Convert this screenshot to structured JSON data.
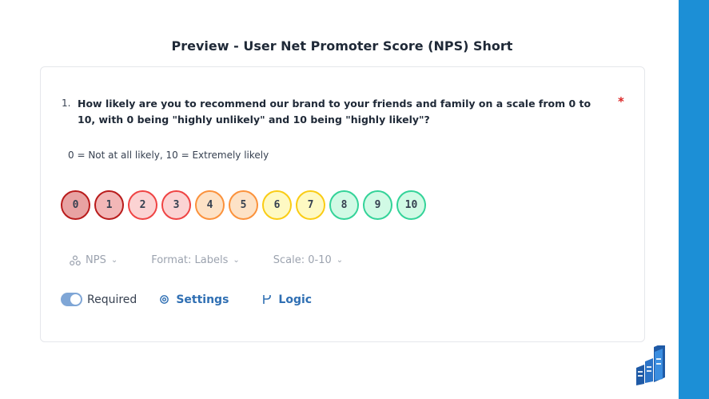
{
  "header": {
    "title": "Preview - User Net Promoter Score (NPS) Short"
  },
  "question": {
    "number": "1.",
    "text": "How likely are you to recommend our brand to your friends and family on a scale from 0 to 10, with 0 being \"highly unlikely\" and 10 being \"highly likely\"?",
    "required_marker": "*",
    "hint": "0 = Not at all likely, 10 = Extremely likely"
  },
  "scale": {
    "options": [
      {
        "label": "0",
        "bg": "#e8a3a3",
        "border": "#b91c1c"
      },
      {
        "label": "1",
        "bg": "#f2b7b7",
        "border": "#b91c1c"
      },
      {
        "label": "2",
        "bg": "#fbd3d3",
        "border": "#ef4444"
      },
      {
        "label": "3",
        "bg": "#fbd3d3",
        "border": "#ef4444"
      },
      {
        "label": "4",
        "bg": "#fde2c6",
        "border": "#fb923c"
      },
      {
        "label": "5",
        "bg": "#fde2c6",
        "border": "#fb923c"
      },
      {
        "label": "6",
        "bg": "#fef9c3",
        "border": "#facc15"
      },
      {
        "label": "7",
        "bg": "#fef9c3",
        "border": "#facc15"
      },
      {
        "label": "8",
        "bg": "#d1fae5",
        "border": "#34d399"
      },
      {
        "label": "9",
        "bg": "#d1fae5",
        "border": "#34d399"
      },
      {
        "label": "10",
        "bg": "#d1fae5",
        "border": "#34d399"
      }
    ]
  },
  "meta": {
    "type_label": "NPS",
    "format_label": "Format: Labels",
    "scale_label": "Scale: 0-10"
  },
  "actions": {
    "required_label": "Required",
    "required_on": true,
    "settings_label": "Settings",
    "logic_label": "Logic"
  },
  "colors": {
    "accent": "#2f6fb3",
    "band": "#1c8fd6",
    "toggle": "#7fa6d6"
  },
  "icons": [
    "nps-type-icon",
    "chevron-down-icon",
    "gear-icon",
    "logic-branch-icon",
    "brand-logo-icon"
  ]
}
